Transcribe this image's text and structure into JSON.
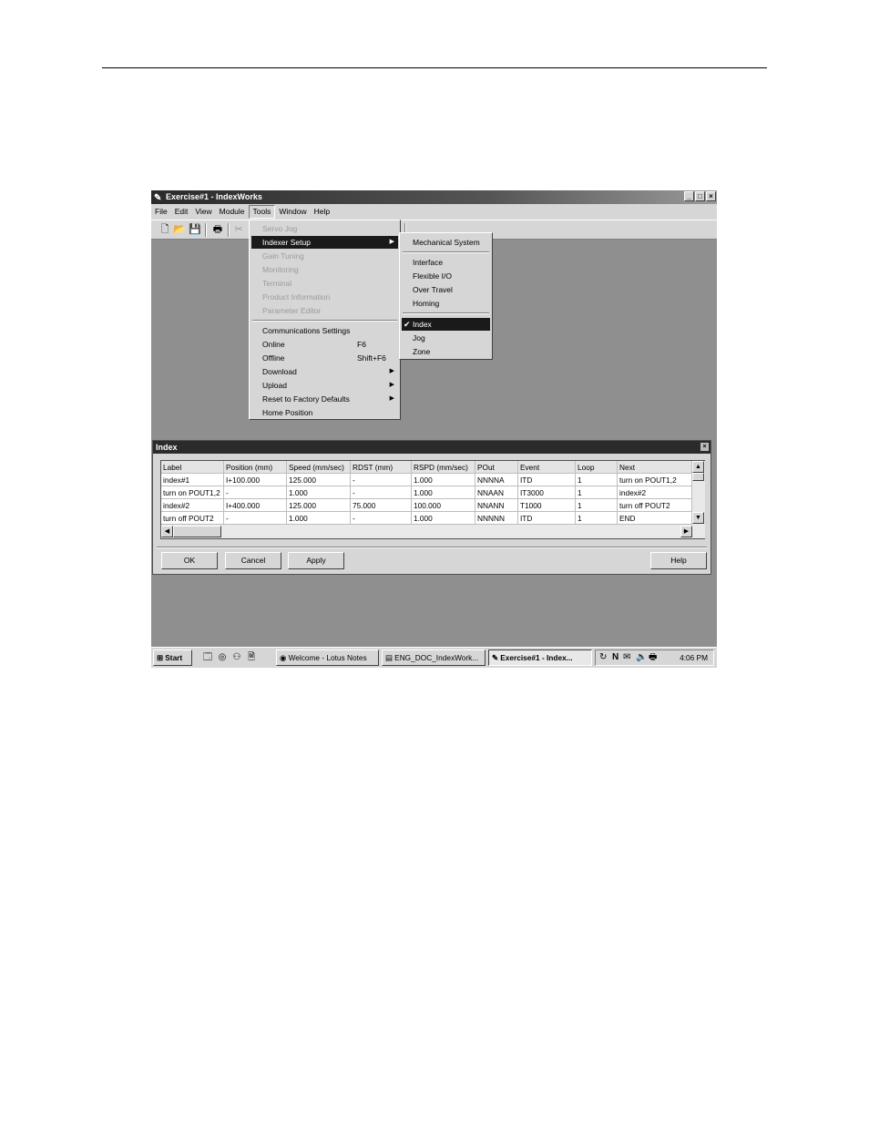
{
  "app": {
    "title": "Exercise#1 - IndexWorks",
    "window_controls": [
      "_",
      "□",
      "×"
    ]
  },
  "menubar": [
    "File",
    "Edit",
    "View",
    "Module",
    "Tools",
    "Window",
    "Help"
  ],
  "tools_menu": {
    "items": [
      {
        "label": "Servo Jog",
        "disabled": true
      },
      {
        "label": "Indexer Setup",
        "submenu": true,
        "highlighted": true
      },
      {
        "label": "Gain Tuning",
        "disabled": true
      },
      {
        "label": "Monitoring",
        "disabled": true
      },
      {
        "label": "Terminal",
        "disabled": true
      },
      {
        "label": "Product Information",
        "disabled": true
      },
      {
        "label": "Parameter Editor",
        "disabled": true
      },
      {
        "separator": true
      },
      {
        "label": "Communications Settings"
      },
      {
        "label": "Online",
        "shortcut": "F6"
      },
      {
        "label": "Offline",
        "shortcut": "Shift+F6"
      },
      {
        "label": "Download",
        "submenu": true
      },
      {
        "label": "Upload",
        "submenu": true
      },
      {
        "label": "Reset to Factory Defaults",
        "submenu": true
      },
      {
        "label": "Home Position"
      }
    ]
  },
  "indexer_submenu": {
    "items": [
      {
        "label": "Mechanical System"
      },
      {
        "separator": true
      },
      {
        "label": "Interface"
      },
      {
        "label": "Flexible I/O"
      },
      {
        "label": "Over Travel"
      },
      {
        "label": "Homing"
      },
      {
        "separator": true
      },
      {
        "label": "Index",
        "checked": true,
        "highlighted": true
      },
      {
        "label": "Jog"
      },
      {
        "label": "Zone"
      }
    ]
  },
  "index_dialog": {
    "title": "Index",
    "close": "×",
    "columns": [
      "Label",
      "Position (mm)",
      "Speed (mm/sec)",
      "RDST (mm)",
      "RSPD (mm/sec)",
      "POut",
      "Event",
      "Loop",
      "Next"
    ],
    "rows": [
      [
        "index#1",
        "I+100.000",
        "125.000",
        "-",
        "1.000",
        "NNNNA",
        "ITD",
        "1",
        "turn on POUT1,2"
      ],
      [
        "turn on POUT1,2",
        "-",
        "1.000",
        "-",
        "1.000",
        "NNAAN",
        "IT3000",
        "1",
        "index#2"
      ],
      [
        "index#2",
        "I+400.000",
        "125.000",
        "75.000",
        "100.000",
        "NNANN",
        "T1000",
        "1",
        "turn off POUT2"
      ],
      [
        "turn off POUT2",
        "-",
        "1.000",
        "-",
        "1.000",
        "NNNNN",
        "ITD",
        "1",
        "END"
      ]
    ],
    "buttons": {
      "ok": "OK",
      "cancel": "Cancel",
      "apply": "Apply",
      "help": "Help"
    }
  },
  "taskbar": {
    "start": "Start",
    "tasks": [
      "Welcome - Lotus Notes",
      "ENG_DOC_IndexWork...",
      "Exercise#1 - Index..."
    ],
    "clock": "4:06 PM"
  }
}
